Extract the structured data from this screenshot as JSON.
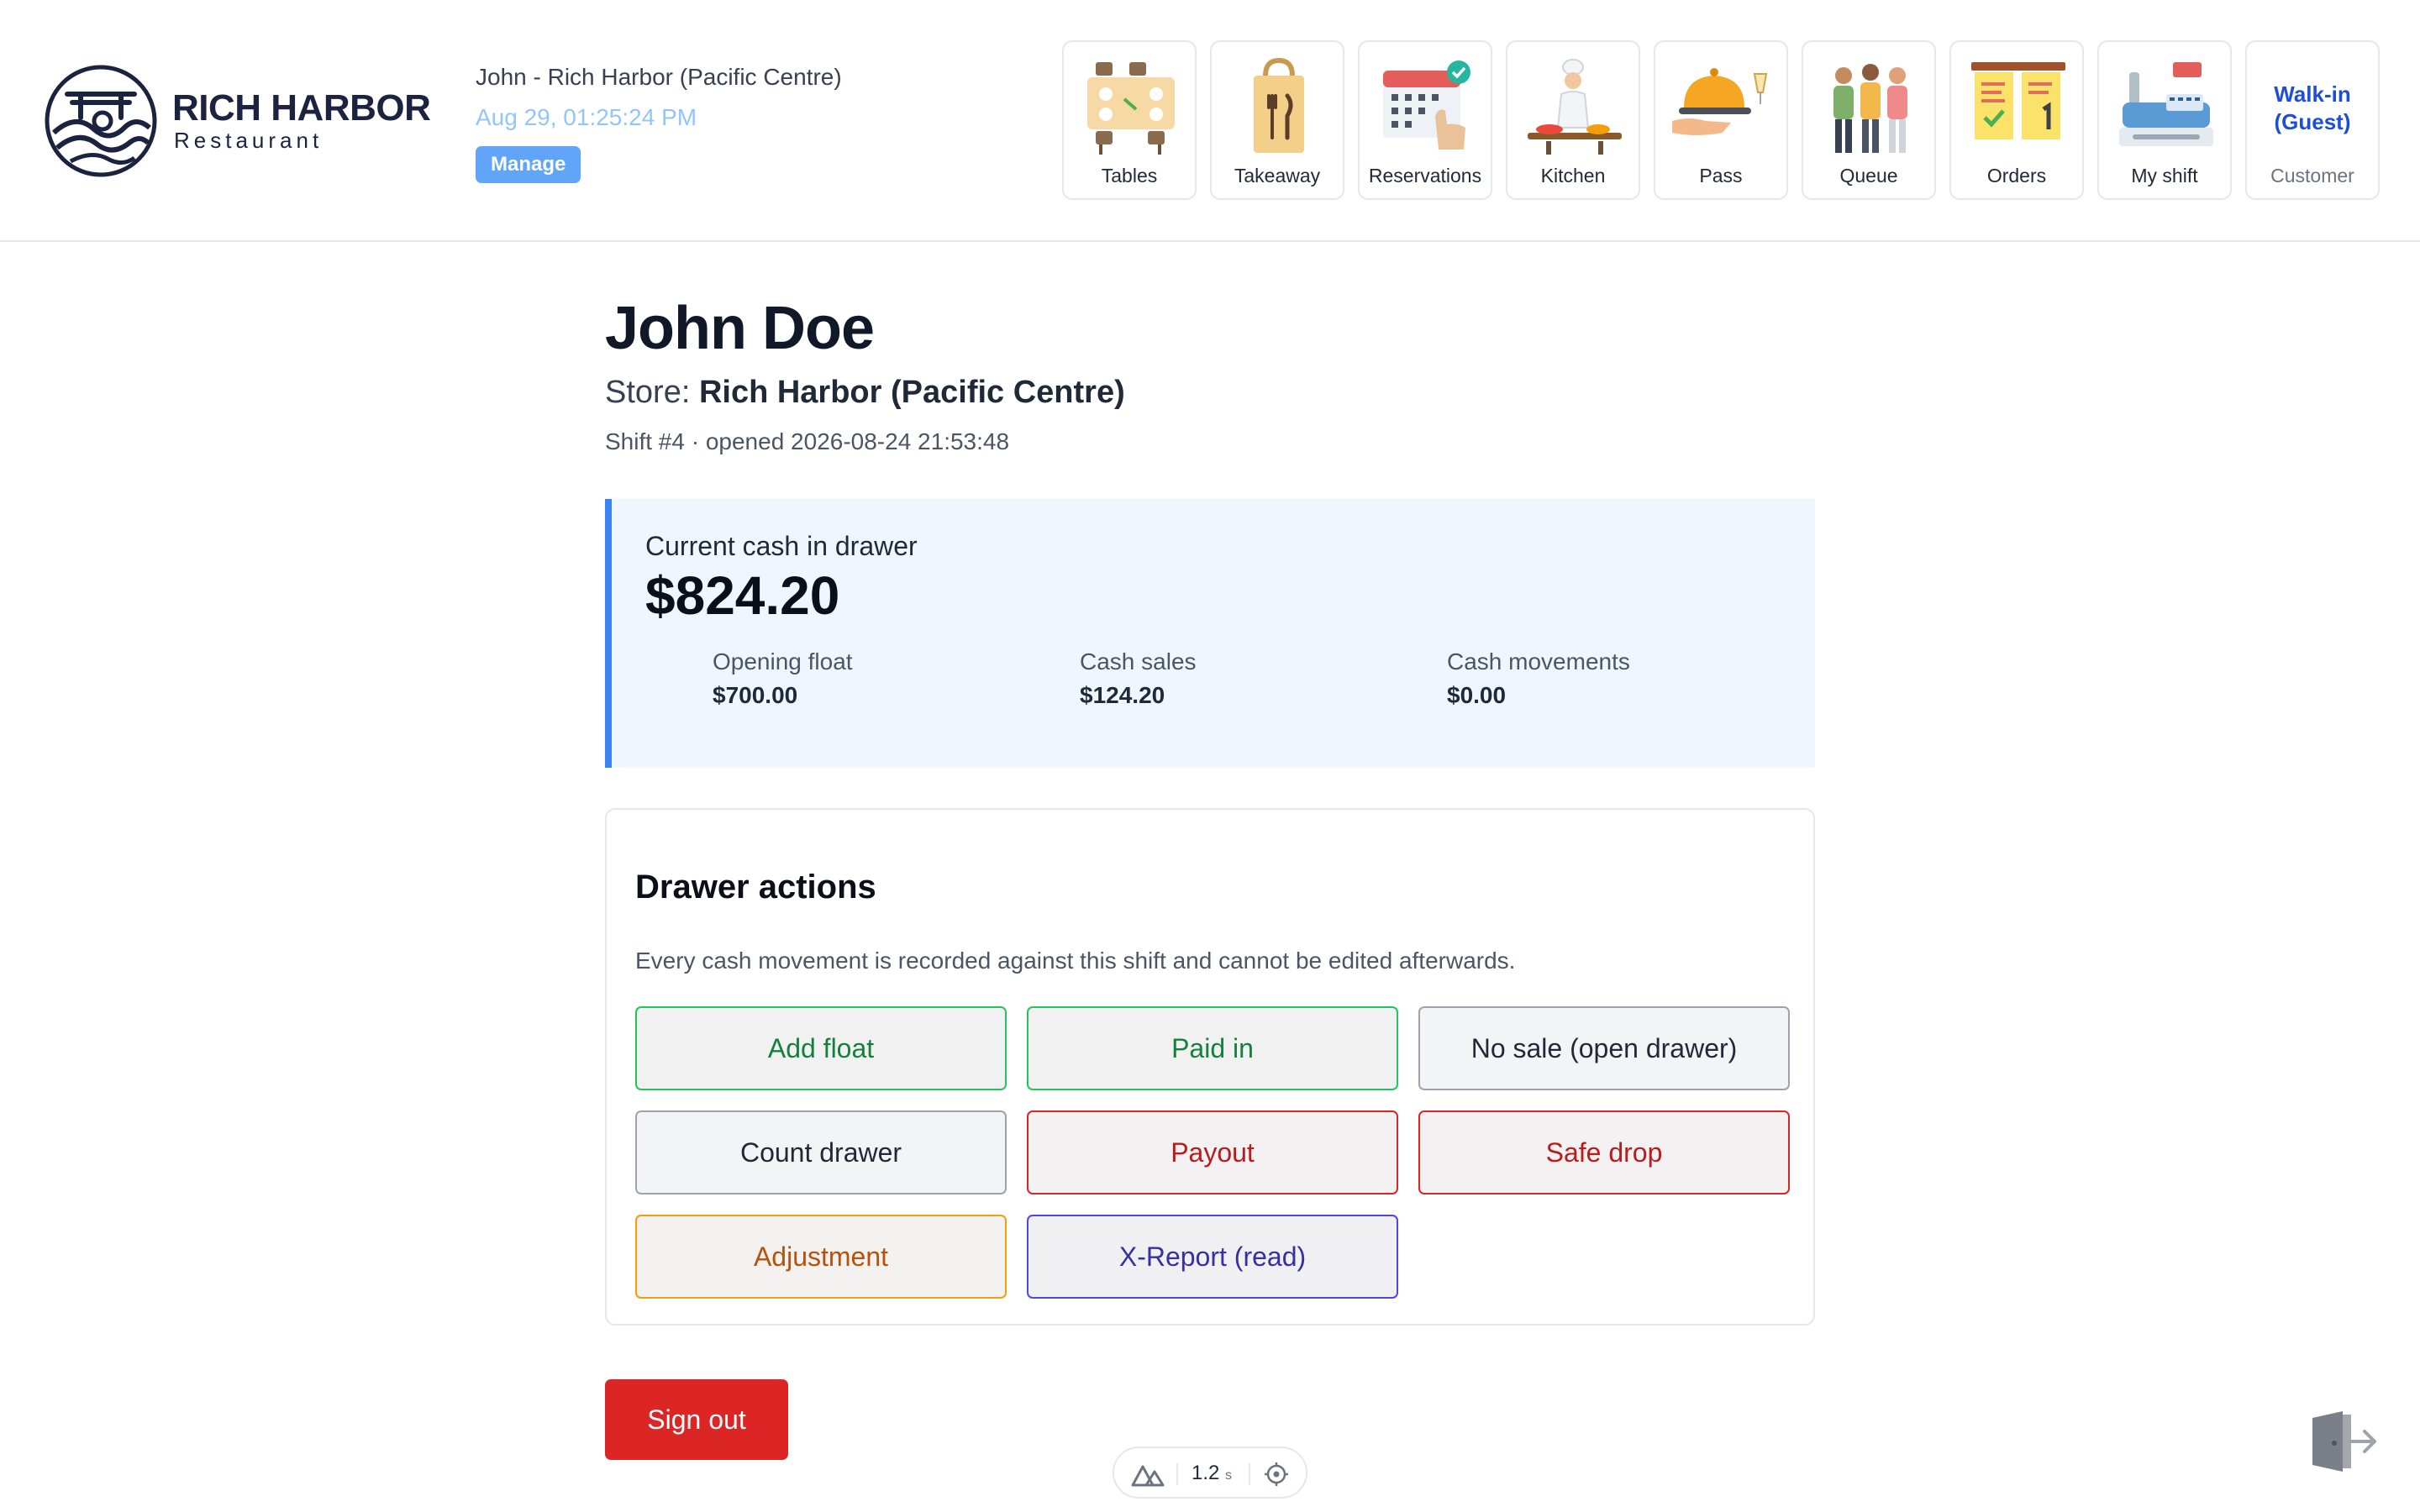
{
  "brand": {
    "name": "RICH HARBOR",
    "subtitle": "Restaurant"
  },
  "session": {
    "user_store": "John - Rich Harbor (Pacific Centre)",
    "datetime": "Aug 29, 01:25:24 PM",
    "manage_label": "Manage"
  },
  "nav": [
    {
      "label": "Tables",
      "icon": "tables-icon"
    },
    {
      "label": "Takeaway",
      "icon": "takeaway-bag-icon"
    },
    {
      "label": "Reservations",
      "icon": "reservations-calendar-icon"
    },
    {
      "label": "Kitchen",
      "icon": "chef-icon"
    },
    {
      "label": "Pass",
      "icon": "serving-cloche-icon"
    },
    {
      "label": "Queue",
      "icon": "queue-people-icon"
    },
    {
      "label": "Orders",
      "icon": "order-tickets-icon"
    },
    {
      "label": "My shift",
      "icon": "cash-register-icon"
    }
  ],
  "customer": {
    "name_line1": "Walk-in",
    "name_line2": "(Guest)",
    "label": "Customer"
  },
  "page": {
    "name": "John Doe",
    "store_prefix": "Store:",
    "store_name": "Rich Harbor (Pacific Centre)",
    "shift_info": "Shift #4 · opened 2026-08-24 21:53:48"
  },
  "cash": {
    "label": "Current cash in drawer",
    "amount": "$824.20",
    "opening_float_label": "Opening float",
    "opening_float": "$700.00",
    "cash_sales_label": "Cash sales",
    "cash_sales": "$124.20",
    "cash_movements_label": "Cash movements",
    "cash_movements": "$0.00",
    "accent_color": "#3b82f6"
  },
  "drawer_actions": {
    "title": "Drawer actions",
    "description": "Every cash movement is recorded against this shift and cannot be edited afterwards.",
    "buttons": [
      {
        "label": "Add float"
      },
      {
        "label": "Paid in"
      },
      {
        "label": "No sale (open drawer)"
      },
      {
        "label": "Count drawer"
      },
      {
        "label": "Payout"
      },
      {
        "label": "Safe drop"
      },
      {
        "label": "Adjustment"
      },
      {
        "label": "X-Report (read)"
      }
    ]
  },
  "signout_label": "Sign out",
  "devtools": {
    "timing_value": "1.2",
    "timing_unit": "s"
  }
}
